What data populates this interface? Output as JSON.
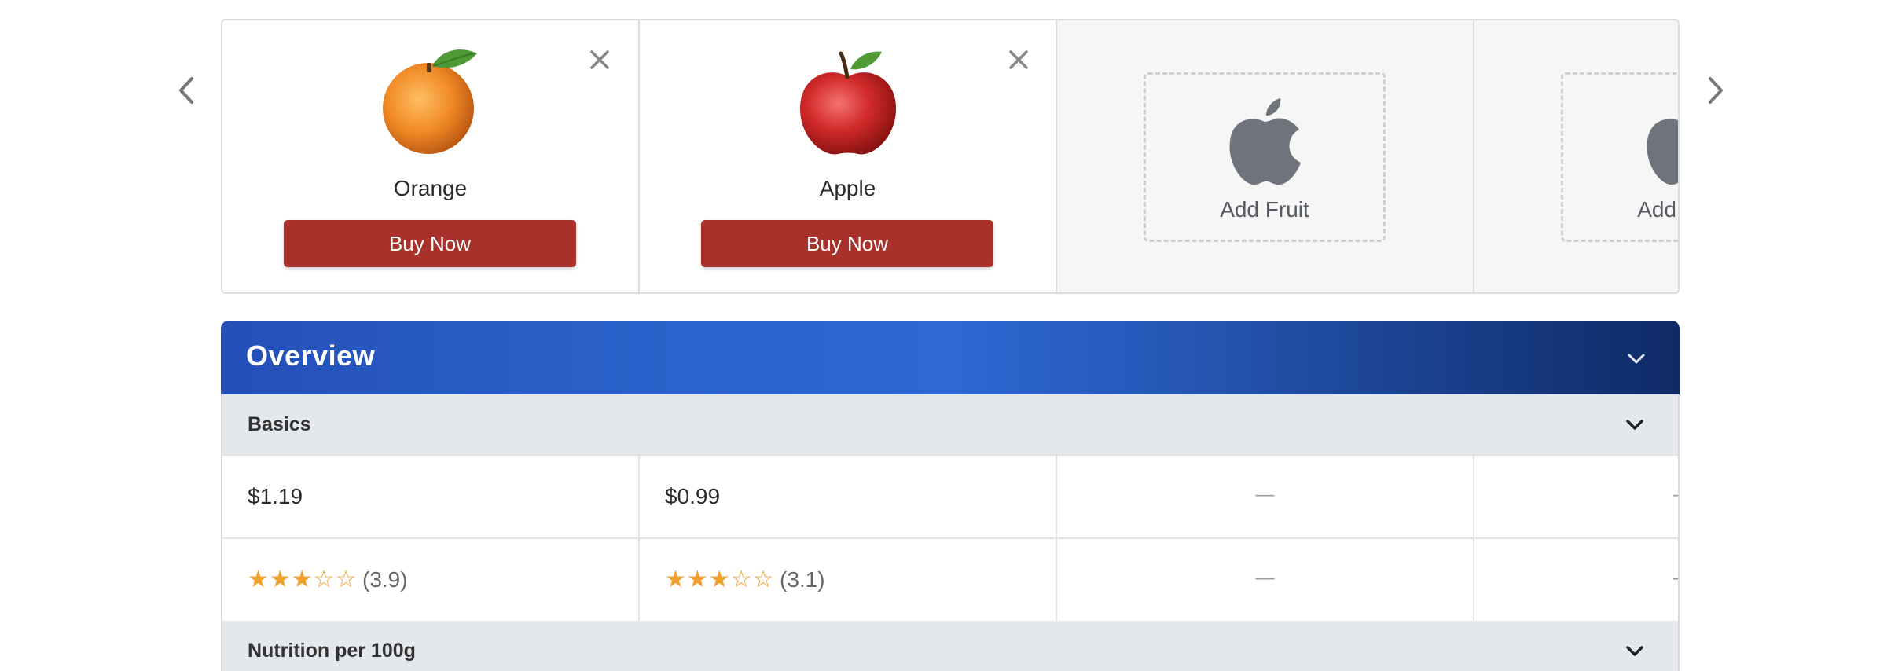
{
  "nav": {
    "prev_icon": "chevron-left-icon",
    "next_icon": "chevron-right-icon"
  },
  "cards": [
    {
      "name": "Orange",
      "buy_label": "Buy Now",
      "icon": "orange-icon"
    },
    {
      "name": "Apple",
      "buy_label": "Buy Now",
      "icon": "apple-icon"
    }
  ],
  "empty_slots": [
    {
      "label": "Add Fruit",
      "icon": "apple-logo-icon"
    },
    {
      "label": "Add Fruit",
      "icon": "apple-logo-icon"
    }
  ],
  "overview": {
    "title": "Overview"
  },
  "sections": {
    "basics": {
      "label": "Basics"
    },
    "nutrition": {
      "label": "Nutrition per 100g"
    }
  },
  "rows": {
    "price": {
      "values": [
        "$1.19",
        "$0.99",
        "—",
        "—"
      ]
    },
    "rating": {
      "values": [
        {
          "stars": "★★★☆☆",
          "score": "(3.9)"
        },
        {
          "stars": "★★★☆☆",
          "score": "(3.1)"
        }
      ],
      "empty": [
        "—",
        "—"
      ]
    }
  },
  "colors": {
    "buy_button": "#a8312c",
    "overview_gradient_start": "#2450b8",
    "overview_gradient_end": "#0f2a66",
    "star": "#f0a02c"
  }
}
